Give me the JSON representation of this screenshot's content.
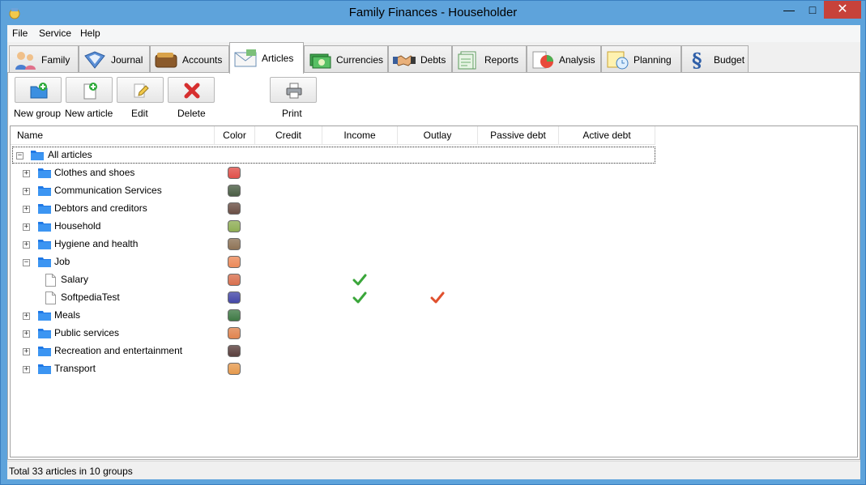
{
  "window": {
    "title": "Family Finances - Householder"
  },
  "menu": [
    "File",
    "Service",
    "Help"
  ],
  "tabs": [
    {
      "label": "Family",
      "icon": "family-icon"
    },
    {
      "label": "Journal",
      "icon": "journal-icon"
    },
    {
      "label": "Accounts",
      "icon": "wallet-icon"
    },
    {
      "label": "Articles",
      "icon": "envelope-icon",
      "active": true
    },
    {
      "label": "Currencies",
      "icon": "money-icon"
    },
    {
      "label": "Debts",
      "icon": "handshake-icon"
    },
    {
      "label": "Reports",
      "icon": "report-icon"
    },
    {
      "label": "Analysis",
      "icon": "pie-chart-icon"
    },
    {
      "label": "Planning",
      "icon": "calendar-clock-icon"
    },
    {
      "label": "Budget",
      "icon": "paragraph-icon"
    }
  ],
  "toolbar": {
    "new_group": "New group",
    "new_article": "New article",
    "edit": "Edit",
    "delete": "Delete",
    "print": "Print"
  },
  "columns": [
    "Name",
    "Color",
    "Credit",
    "Income",
    "Outlay",
    "Passive debt",
    "Active debt"
  ],
  "tree": {
    "root": "All articles",
    "rows": [
      {
        "label": "Clothes and shoes",
        "type": "group",
        "expanded": false,
        "color": "#e0504a"
      },
      {
        "label": "Communication Services",
        "type": "group",
        "expanded": false,
        "color": "#4b5e45"
      },
      {
        "label": "Debtors and creditors",
        "type": "group",
        "expanded": false,
        "color": "#6b4f45"
      },
      {
        "label": "Household",
        "type": "group",
        "expanded": false,
        "color": "#8fae55"
      },
      {
        "label": "Hygiene and health",
        "type": "group",
        "expanded": false,
        "color": "#8e7356"
      },
      {
        "label": "Job",
        "type": "group",
        "expanded": true,
        "color": "#ec8a5a"
      },
      {
        "label": "Salary",
        "type": "article",
        "color": "#d9704f",
        "income": true,
        "outlay": false
      },
      {
        "label": "SoftpediaTest",
        "type": "article",
        "color": "#4548a8",
        "income": true,
        "outlay": true
      },
      {
        "label": "Meals",
        "type": "group",
        "expanded": false,
        "color": "#3f7a45"
      },
      {
        "label": "Public services",
        "type": "group",
        "expanded": false,
        "color": "#e0844f"
      },
      {
        "label": "Recreation and entertainment",
        "type": "group",
        "expanded": false,
        "color": "#5a3f3d"
      },
      {
        "label": "Transport",
        "type": "group",
        "expanded": false,
        "color": "#e69a4e"
      }
    ]
  },
  "status": "Total 33 articles in 10 groups"
}
